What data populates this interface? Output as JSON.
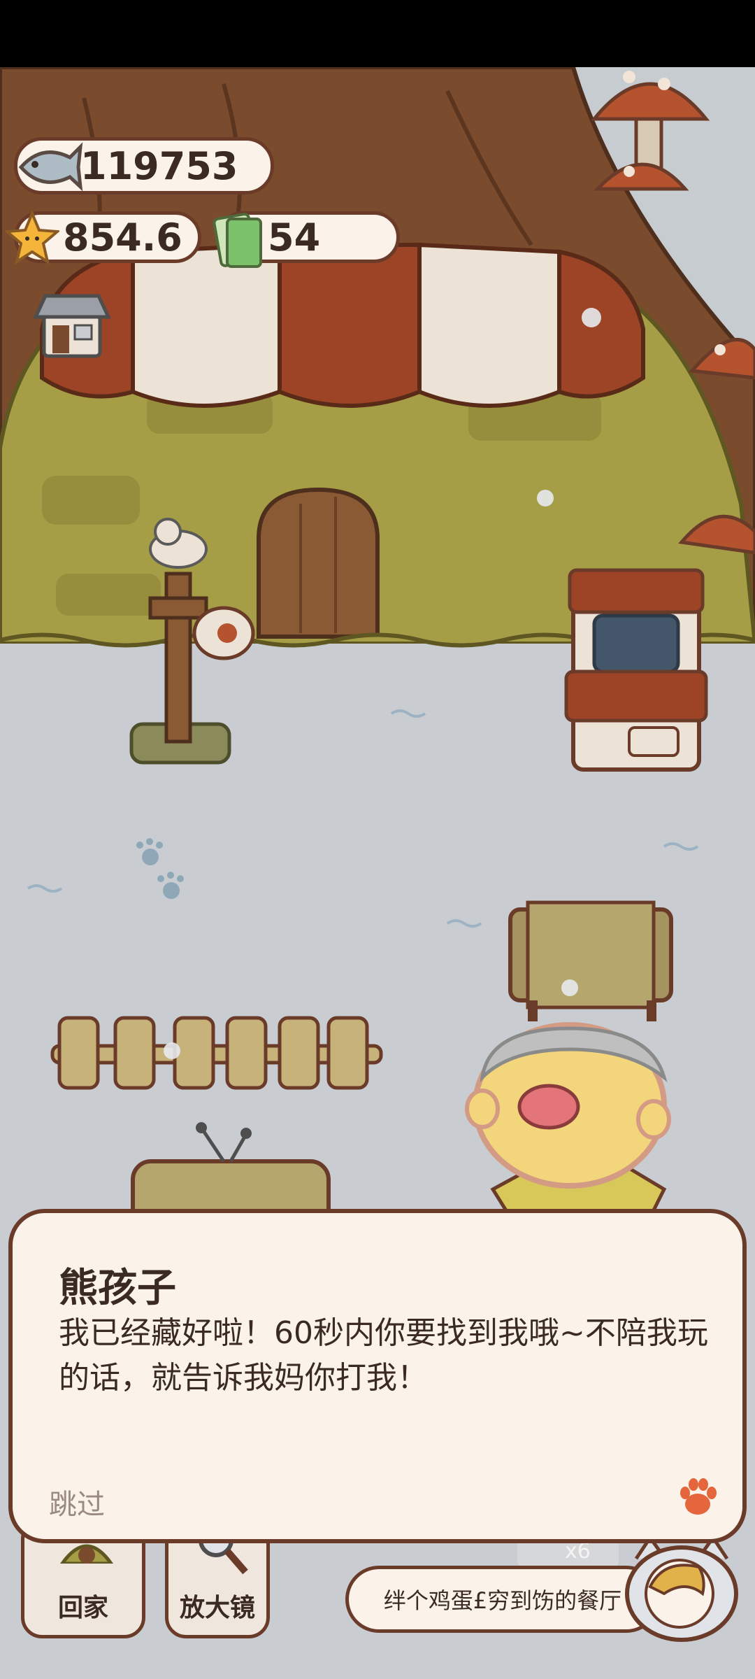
{
  "hud": {
    "fish": "119753",
    "stars": "854.6",
    "tickets": "54",
    "shop_icon": "shop-icon"
  },
  "dialog": {
    "speaker": "熊孩子",
    "message": "我已经藏好啦！60秒内你要找到我哦~不陪我玩的话，就告诉我妈你打我！",
    "skip": "跳过",
    "next_icon": "paw-icon"
  },
  "bottom": {
    "home_label": "回家",
    "magnifier_label": "放大镜",
    "quest_text": "绊个鸡蛋£穷到饬的餐厅",
    "count_label": "x6"
  },
  "colors": {
    "outline": "#6b3b2a",
    "panel": "#fbf3ea",
    "ground": "#c9cdd2",
    "moss": "#a69e46",
    "accent_paw": "#e5663c"
  }
}
